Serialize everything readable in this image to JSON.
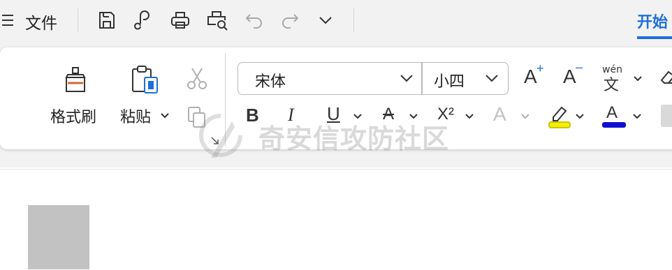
{
  "quick_access": {
    "menu_label": "文件",
    "icons": [
      "menu-icon",
      "save-icon",
      "share-icon",
      "print-icon",
      "print-preview-icon",
      "undo-icon",
      "redo-icon",
      "more-chevron-icon"
    ]
  },
  "tabs": {
    "active": "开始"
  },
  "ribbon": {
    "format_painter_label": "格式刷",
    "paste_label": "粘贴",
    "font_name": "宋体",
    "font_size": "小四",
    "bold": "B",
    "italic": "I",
    "underline": "U",
    "strikethrough": "A",
    "superscript": "X²",
    "grow_font": "A",
    "shrink_font": "A",
    "text_effect": "A",
    "font_color": "A",
    "phonetic": "wén"
  },
  "colors": {
    "accent": "#1e6fd9",
    "highlight": "#f5f000",
    "font_color": "#1010d0"
  },
  "watermark_text": "奇安信攻防社区"
}
